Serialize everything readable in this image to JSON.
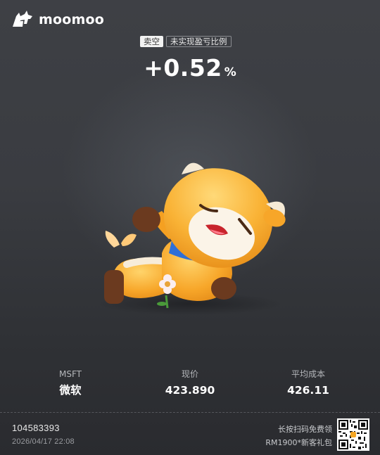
{
  "brand": {
    "name": "moomoo"
  },
  "header": {
    "position_tag": "卖空",
    "metric_tag": "未实现盈亏比例",
    "percent_value": "+0.52",
    "percent_unit": "%"
  },
  "stats": [
    {
      "label": "MSFT",
      "value": "微软"
    },
    {
      "label": "现价",
      "value": "423.890"
    },
    {
      "label": "平均成本",
      "value": "426.11"
    }
  ],
  "footer": {
    "account_id": "104583393",
    "timestamp": "2026/04/17 22:08",
    "promo_line1": "长按扫码免费领",
    "promo_line2": "RM1900*新客礼包"
  },
  "colors": {
    "accent_orange": "#f5a623",
    "background": "#3a3c41"
  },
  "icons": {
    "logo": "moomoo-bull-logo-icon",
    "qr": "qr-code-icon"
  }
}
